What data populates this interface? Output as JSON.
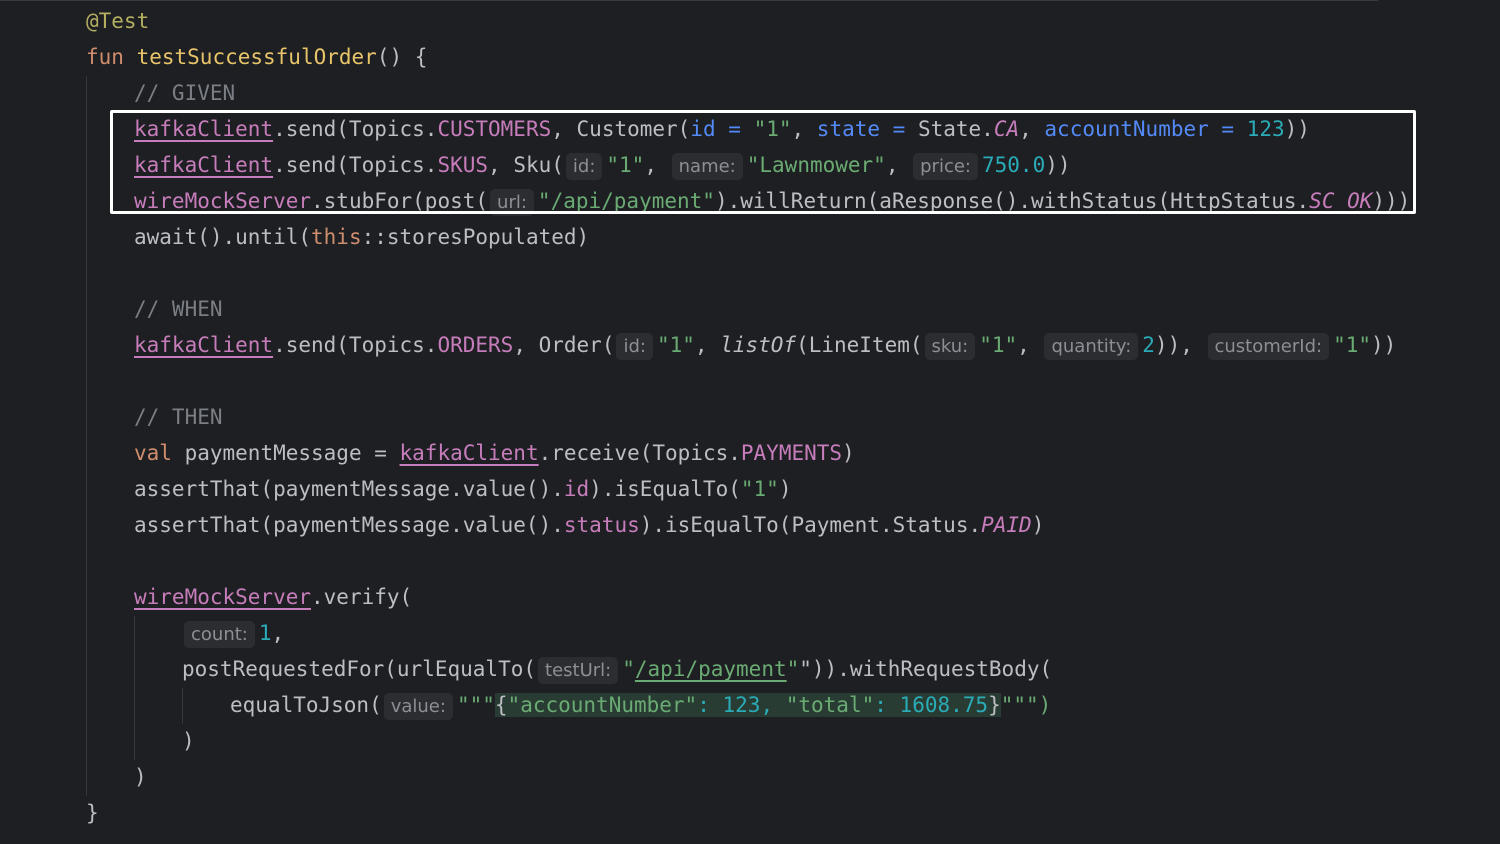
{
  "code": {
    "annotation": "@Test",
    "fun_kw": "fun",
    "test_name": "testSuccessfulOrder",
    "sig_rest": "() {",
    "comment_given": "// GIVEN",
    "comment_when": "// WHEN",
    "comment_then": "// THEN",
    "kafka_client": "kafkaClient",
    "wiremock_server": "wireMockServer",
    "send": ".send(Topics.",
    "customers": "CUSTOMERS",
    "customer_ctor": ", Customer(",
    "id_named": "id",
    "state_named": "state",
    "account_named": "accountNumber",
    "eq": " = ",
    "str_1": "\"1\"",
    "comma": ", ",
    "state_prefix": "State.",
    "state_ca": "CA",
    "num_123": "123",
    "close2": "))",
    "skus": "SKUS",
    "sku_ctor": ", Sku(",
    "lawnmower": "\"Lawnmower\"",
    "num_750": "750.0",
    "stub_for": ".stubFor(post(",
    "quote": "\"",
    "api_payment": "/api/payment",
    "will_return": ").willReturn(aResponse().withStatus(HttpStatus.",
    "sc_ok": "SC_OK",
    "close3": ")))",
    "await_pre": "await().until(",
    "this_kw": "this",
    "await_post": "::storesPopulated)",
    "orders": "ORDERS",
    "order_ctor": ", Order(",
    "list_of": "listOf",
    "line_item": "(LineItem(",
    "num_2": "2",
    "close_paren_comma": ")), ",
    "val_kw": "val",
    "payment_message": " paymentMessage = ",
    "receive": ".receive(Topics.",
    "payments": "PAYMENTS",
    "close1": ")",
    "assert_that": "assertThat(paymentMessage.value().",
    "id_prop": "id",
    "is_equal_to": ").isEqualTo(",
    "status_prop": "status",
    "payment_status": "Payment.Status.",
    "paid": "PAID",
    "verify": ".verify(",
    "num_1": "1",
    "comma_only": ",",
    "post_requested": "postRequestedFor(urlEqualTo(",
    "with_request_body": "\")).withRequestBody(",
    "equal_to_json": "equalToJson(",
    "triple_quote": "\"\"\"",
    "json_open": "{",
    "json_account_key": "\"accountNumber\"",
    "json_colon": ": ",
    "json_total_key": "\"total\"",
    "json_1608": "1608.75",
    "json_close": "}",
    "triple_quote_close": "\"\"\")",
    "paren_close": ")",
    "brace_close": "}"
  },
  "hints": {
    "id": "id:",
    "name": "name:",
    "price": "price:",
    "url": "url:",
    "sku": "sku:",
    "quantity": "quantity:",
    "customer_id": "customerId:",
    "count": "count:",
    "test_url": "testUrl:",
    "value": "value:"
  },
  "colors": {
    "background": "#1e1f22",
    "highlight_border": "#ffffff"
  }
}
